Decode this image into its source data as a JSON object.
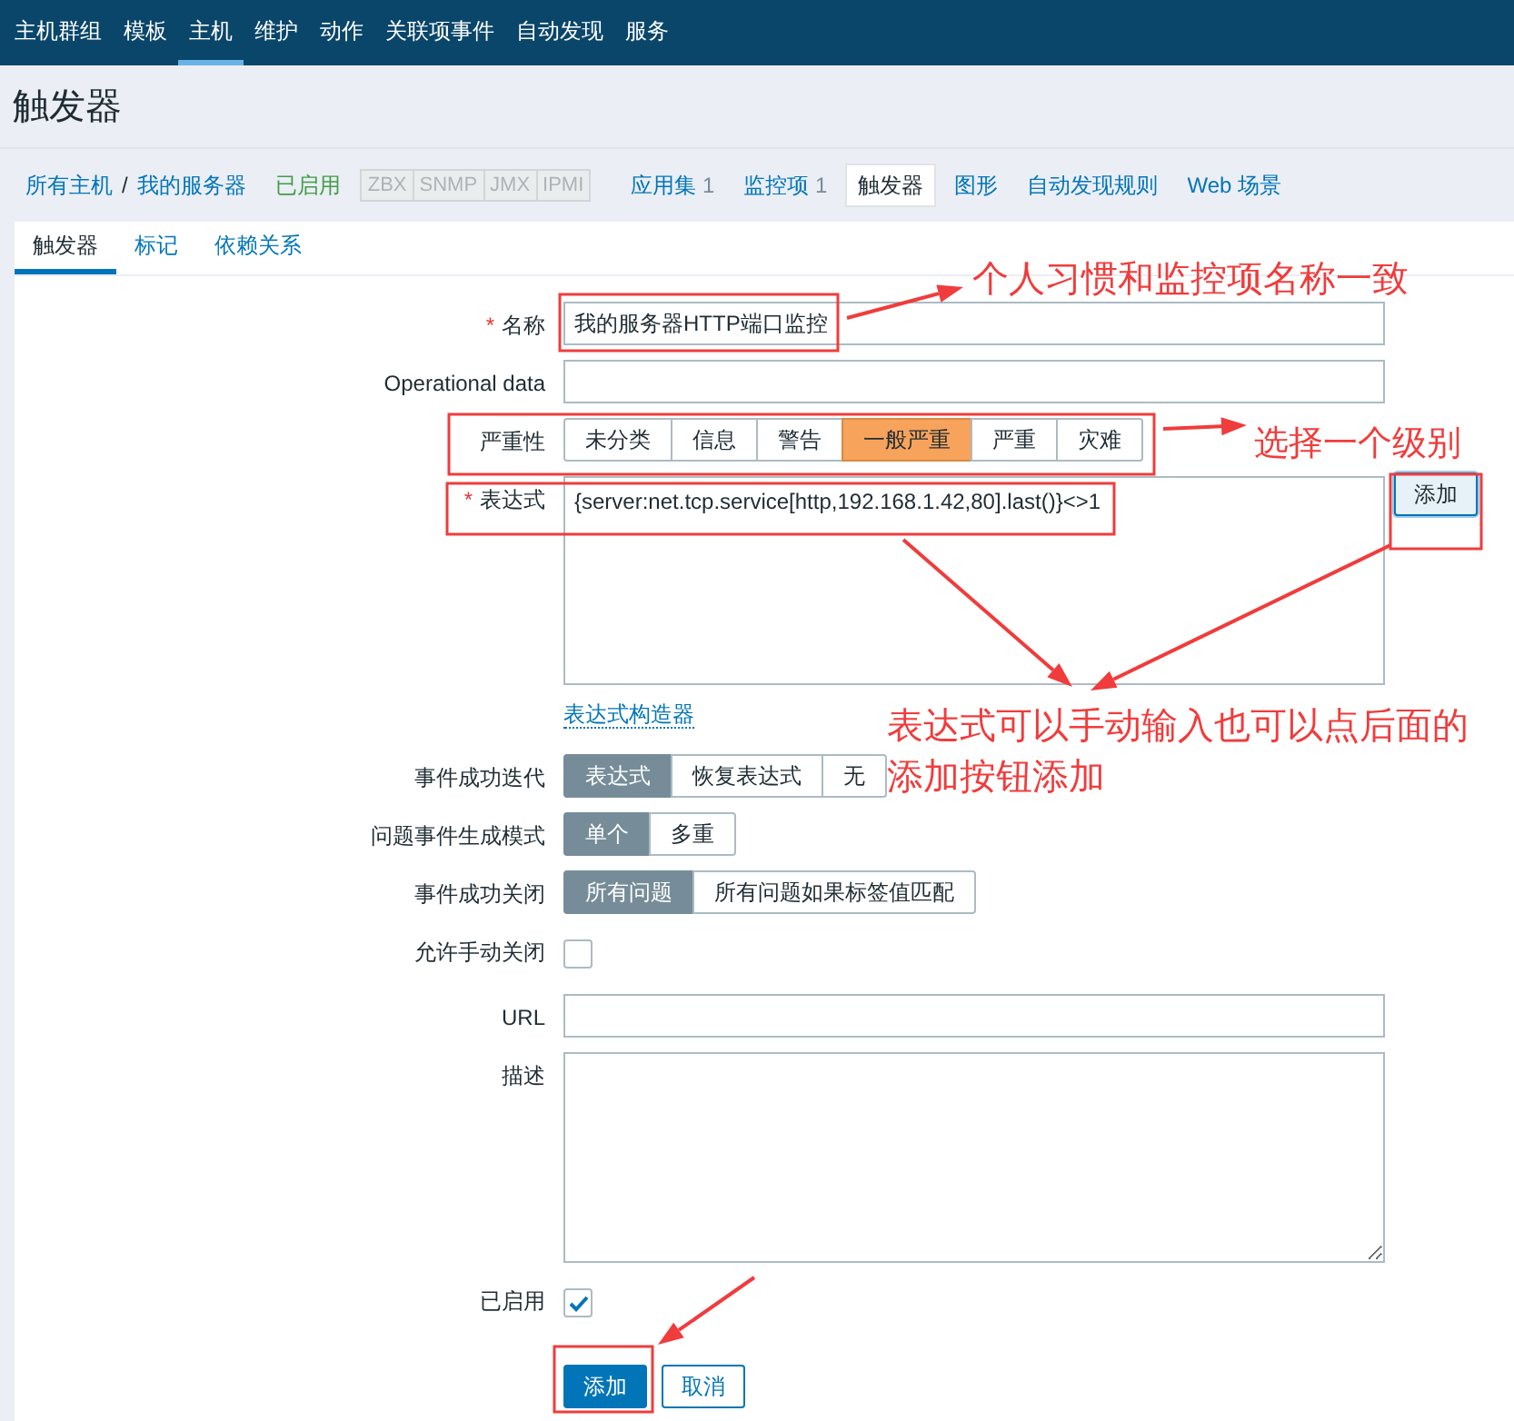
{
  "top_nav": [
    {
      "label": "主机群组",
      "selected": false
    },
    {
      "label": "模板",
      "selected": false
    },
    {
      "label": "主机",
      "selected": true
    },
    {
      "label": "维护",
      "selected": false
    },
    {
      "label": "动作",
      "selected": false
    },
    {
      "label": "关联项事件",
      "selected": false
    },
    {
      "label": "自动发现",
      "selected": false
    },
    {
      "label": "服务",
      "selected": false
    }
  ],
  "page_title": "触发器",
  "breadcrumb": {
    "host_all": "所有主机",
    "separator": "/",
    "host": "我的服务器",
    "status": "已启用",
    "interfaces": [
      "ZBX",
      "SNMP",
      "JMX",
      "IPMI"
    ],
    "links": [
      {
        "label": "应用集",
        "count": "1",
        "selected": false
      },
      {
        "label": "监控项",
        "count": "1",
        "selected": false
      },
      {
        "label": "触发器",
        "selected": true
      },
      {
        "label": "图形",
        "selected": false
      },
      {
        "label": "自动发现规则",
        "selected": false
      },
      {
        "label": "Web 场景",
        "selected": false
      }
    ]
  },
  "tabs": [
    {
      "label": "触发器",
      "selected": true
    },
    {
      "label": "标记",
      "selected": false
    },
    {
      "label": "依赖关系",
      "selected": false
    }
  ],
  "form": {
    "required_mark": "*",
    "rows": [
      {
        "kind": "text",
        "label": "名称",
        "required": true,
        "value": "我的服务器HTTP端口监控"
      },
      {
        "kind": "text",
        "label": "Operational data",
        "required": false
      },
      {
        "kind": "severity",
        "label": "严重性",
        "options": [
          {
            "label": "未分类",
            "selected": false
          },
          {
            "label": "信息",
            "selected": false
          },
          {
            "label": "警告",
            "selected": false
          },
          {
            "label": "一般严重",
            "selected": true
          },
          {
            "label": "严重",
            "selected": false
          },
          {
            "label": "灾难",
            "selected": false
          }
        ]
      },
      {
        "kind": "expression",
        "label": "表达式",
        "required": true,
        "value": "{server:net.tcp.service[http,192.168.1.42,80].last()}<>1",
        "button": "添加",
        "link": "表达式构造器"
      },
      {
        "kind": "segmented",
        "label": "事件成功迭代",
        "options": [
          {
            "label": "表达式",
            "selected": true
          },
          {
            "label": "恢复表达式",
            "selected": false
          },
          {
            "label": "无",
            "selected": false
          }
        ]
      },
      {
        "kind": "segmented",
        "label": "问题事件生成模式",
        "options": [
          {
            "label": "单个",
            "selected": true
          },
          {
            "label": "多重",
            "selected": false
          }
        ]
      },
      {
        "kind": "segmented",
        "label": "事件成功关闭",
        "options": [
          {
            "label": "所有问题",
            "selected": true
          },
          {
            "label": "所有问题如果标签值匹配",
            "selected": false
          }
        ]
      },
      {
        "kind": "checkbox",
        "label": "允许手动关闭",
        "checked": false
      },
      {
        "kind": "text",
        "label": "URL",
        "required": false
      },
      {
        "kind": "textarea",
        "label": "描述"
      },
      {
        "kind": "checkbox",
        "label": "已启用",
        "checked": true
      }
    ],
    "buttons": [
      {
        "label": "添加",
        "kind": "primary"
      },
      {
        "label": "取消",
        "kind": "secondary"
      }
    ]
  },
  "annotations": [
    "个人习惯和监控项名称一致",
    "选择一个级别",
    "表达式可以手动输入也可以点后面的添加按钮添加"
  ]
}
